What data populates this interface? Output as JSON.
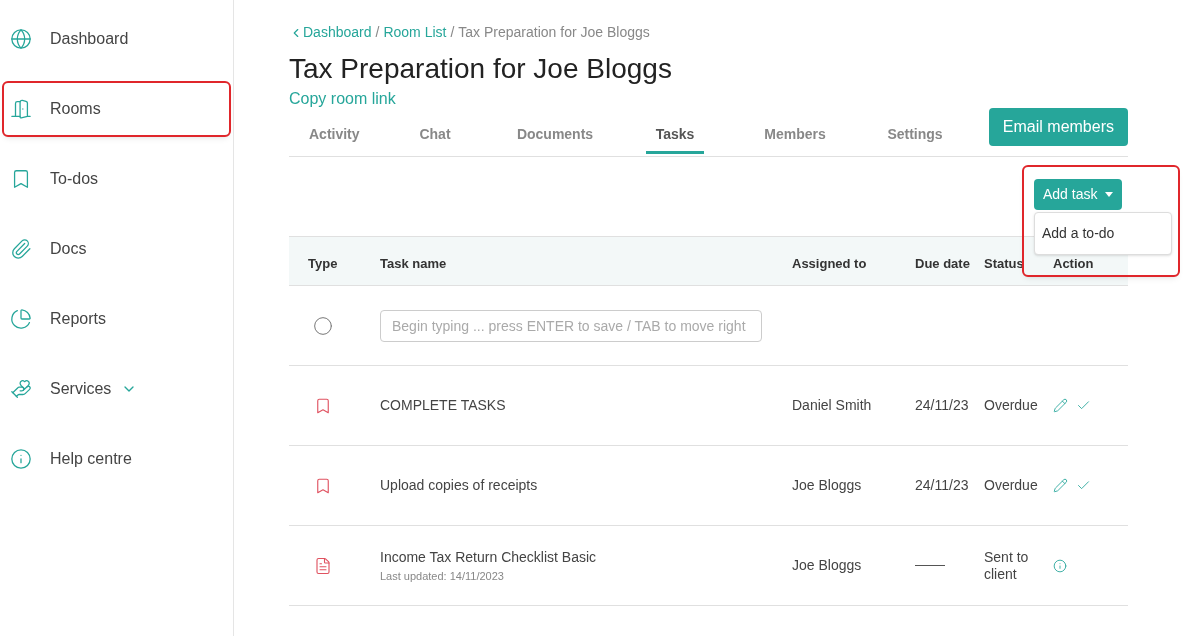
{
  "sidebar": {
    "items": [
      {
        "label": "Dashboard",
        "highlighted": false
      },
      {
        "label": "Rooms",
        "highlighted": true
      },
      {
        "label": "To-dos",
        "highlighted": false
      },
      {
        "label": "Docs",
        "highlighted": false
      },
      {
        "label": "Reports",
        "highlighted": false
      },
      {
        "label": "Services",
        "highlighted": false,
        "expandable": true
      },
      {
        "label": "Help centre",
        "highlighted": false
      }
    ]
  },
  "breadcrumb": {
    "separator": "/",
    "items": [
      "Dashboard",
      "Room List",
      "Tax Preparation for Joe Bloggs"
    ]
  },
  "title": "Tax Preparation for Joe Bloggs",
  "copy_link": "Copy room link",
  "tabs": [
    {
      "label": "Activity",
      "selected": false
    },
    {
      "label": "Chat",
      "selected": false
    },
    {
      "label": "Documents",
      "selected": false
    },
    {
      "label": "Tasks",
      "selected": true
    },
    {
      "label": "Members",
      "selected": false
    },
    {
      "label": "Settings",
      "selected": false
    }
  ],
  "email_button": "Email members",
  "add_task": {
    "label": "Add task",
    "highlighted": true,
    "menu": [
      "Add a to-do"
    ]
  },
  "table": {
    "columns": [
      "Type",
      "Task name",
      "Assigned to",
      "Due date",
      "Status",
      "Action"
    ],
    "new_row": {
      "placeholder": "Begin typing ... press ENTER to save / TAB to move right"
    },
    "rows": [
      {
        "kind": "todo",
        "name": "COMPLETE TASKS",
        "assigned": "Daniel Smith",
        "due": "24/11/23",
        "status": "Overdue"
      },
      {
        "kind": "todo",
        "name": "Upload copies of receipts",
        "assigned": "Joe Bloggs",
        "due": "24/11/23",
        "status": "Overdue"
      },
      {
        "kind": "document",
        "name": "Income Tax Return Checklist Basic",
        "subtitle": "Last updated: 14/11/2023",
        "assigned": "Joe Bloggs",
        "status": "Sent to client"
      }
    ]
  }
}
